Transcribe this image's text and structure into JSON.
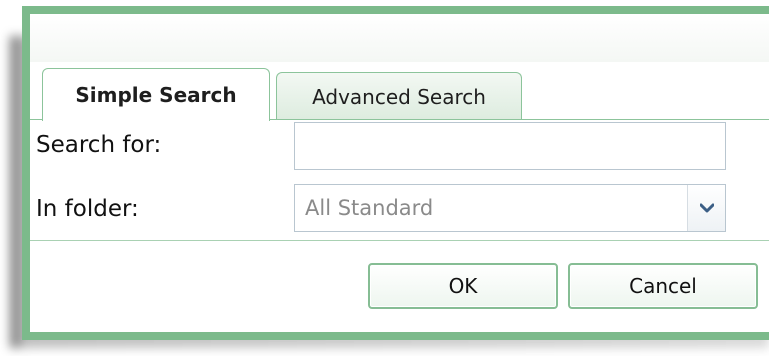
{
  "tabs": [
    {
      "label": "Simple Search",
      "active": true
    },
    {
      "label": "Advanced Search",
      "active": false
    }
  ],
  "form": {
    "search_label": "Search for:",
    "search_value": "",
    "folder_label": "In folder:",
    "folder_value": "All Standard"
  },
  "buttons": {
    "ok_label": "OK",
    "cancel_label": "Cancel"
  },
  "colors": {
    "accent": "#7cba8b",
    "tab_border": "#8cc49b",
    "input_border": "#b9c6d0",
    "arrow": "#3c5f86"
  },
  "icons": {
    "select_arrow": "chevron-down-icon"
  }
}
